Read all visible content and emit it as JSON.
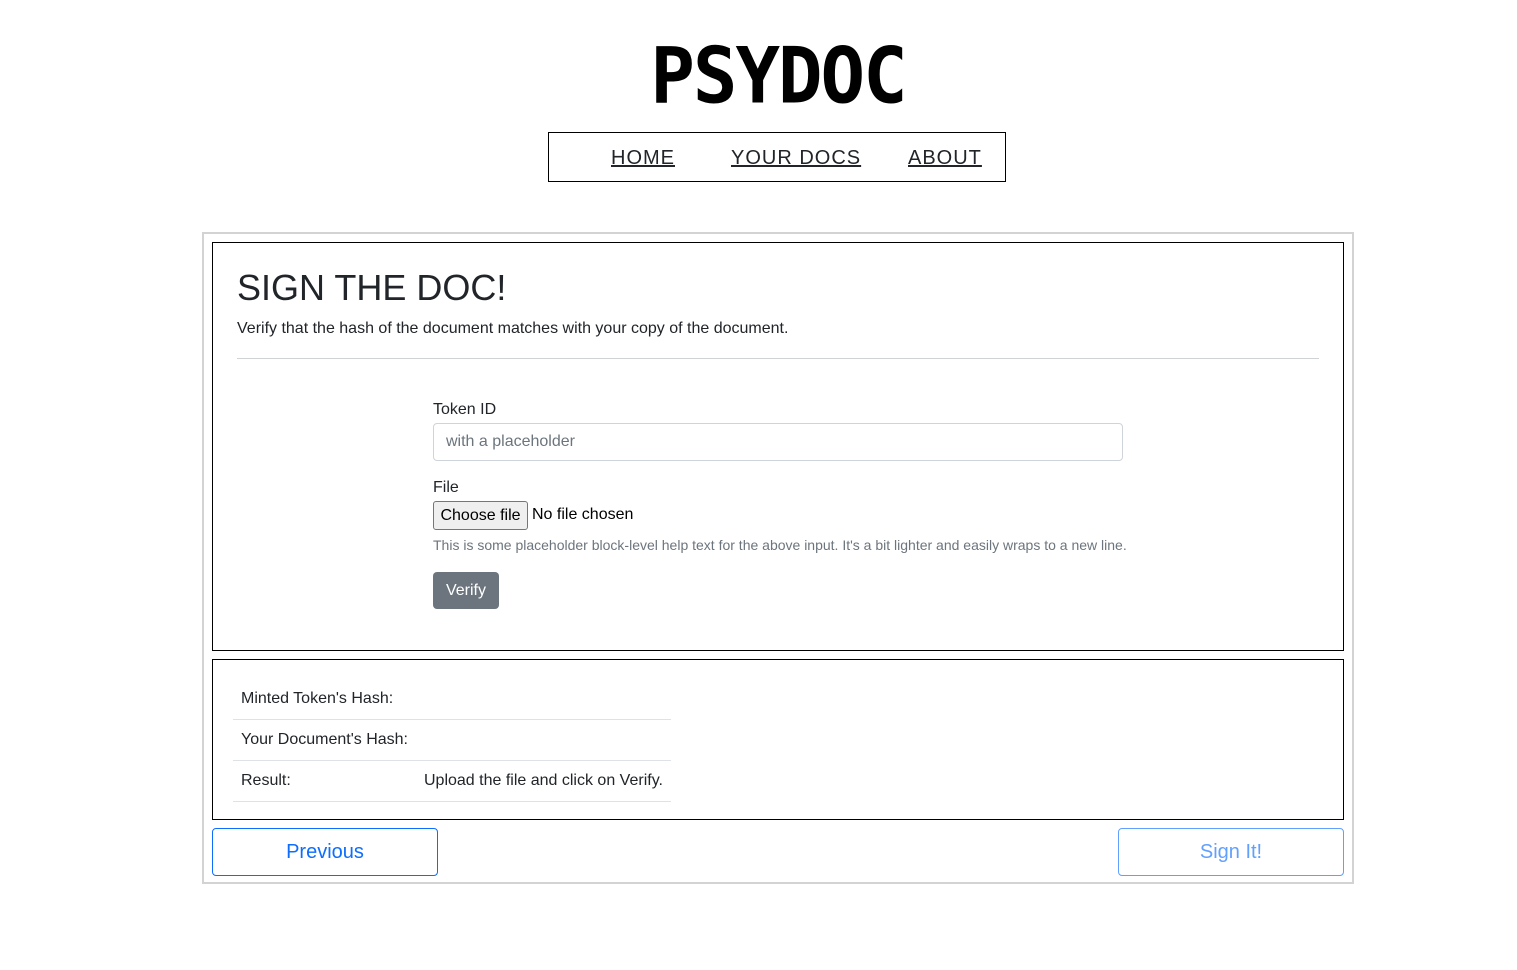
{
  "logo": {
    "text": "PSYDOC"
  },
  "nav": {
    "home": "HOME",
    "your_docs": "YOUR DOCS",
    "about": "ABOUT"
  },
  "header": {
    "title": "SIGN THE DOC!",
    "lead": "Verify that the hash of the document matches with your copy of the document."
  },
  "form": {
    "token_label": "Token ID",
    "token_placeholder": "with a placeholder",
    "token_value": "",
    "file_label": "File",
    "file_button": "Choose file",
    "file_status": "No file chosen",
    "help_text": "This is some placeholder block-level help text for the above input. It's a bit lighter and easily wraps to a new line.",
    "verify_label": "Verify"
  },
  "results": {
    "rows": [
      {
        "label": "Minted Token's Hash:",
        "value": ""
      },
      {
        "label": "Your Document's Hash:",
        "value": ""
      },
      {
        "label": "Result:",
        "value": "Upload the file and click on Verify."
      }
    ]
  },
  "footer": {
    "previous": "Previous",
    "sign": "Sign It!"
  },
  "colors": {
    "primary": "#0d6efd",
    "secondary": "#6c757d",
    "border": "#000000"
  }
}
